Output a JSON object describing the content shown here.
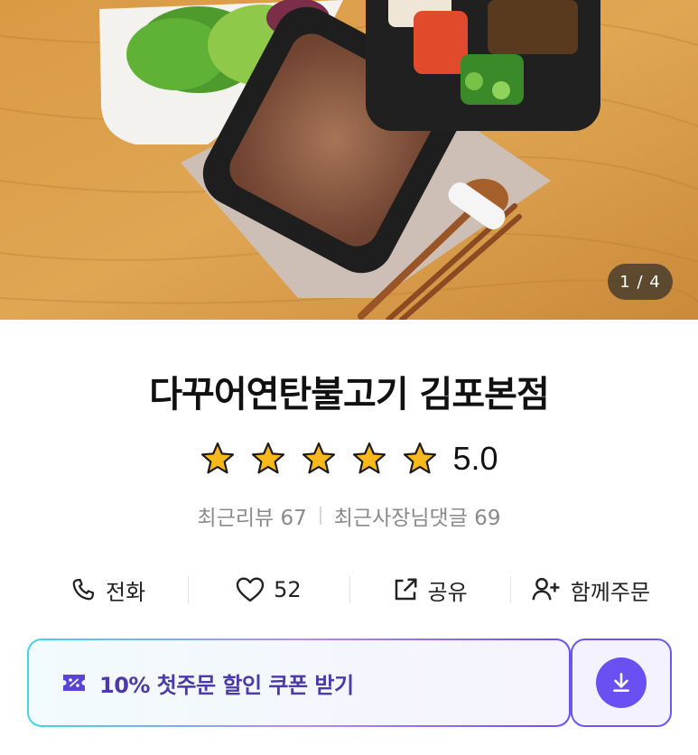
{
  "gallery": {
    "counter": "1 / 4"
  },
  "store": {
    "name": "다꾸어연탄불고기 김포본점",
    "rating": 5.0,
    "rating_text": "5.0",
    "stars": 5,
    "recent_reviews": "최근리뷰 67",
    "recent_owner_replies": "최근사장님댓글 69"
  },
  "actions": {
    "call": "전화",
    "like_count": "52",
    "share": "공유",
    "group_order": "함께주문"
  },
  "coupon": {
    "label": "10% 첫주문 할인 쿠폰 받기"
  },
  "colors": {
    "star": "#f6b81a",
    "coupon_text": "#4b3aa8",
    "accent": "#6a4ff2"
  }
}
